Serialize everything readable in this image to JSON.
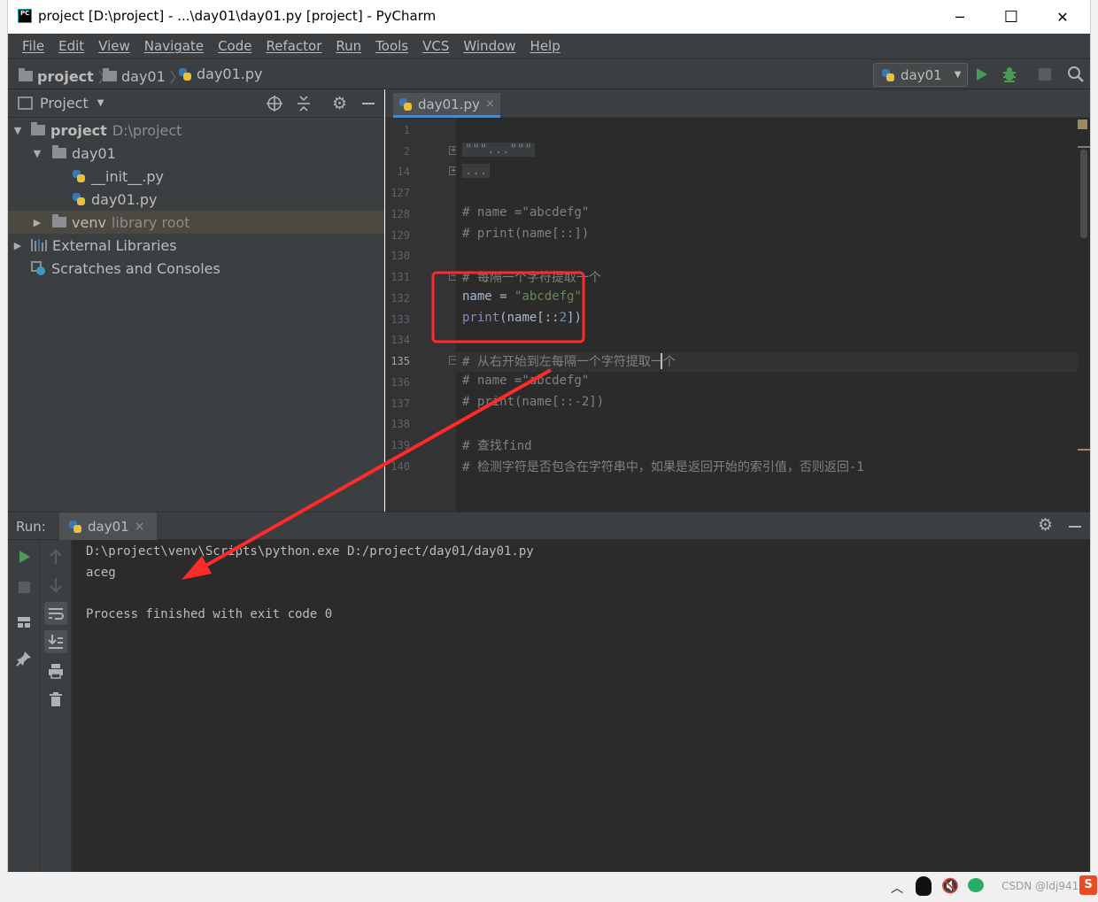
{
  "window": {
    "title": "project [D:\\project] - ...\\day01\\day01.py [project] - PyCharm",
    "logo": "PC",
    "minimize_glyph": "─",
    "maximize_glyph": "☐",
    "close_glyph": "✕"
  },
  "menu": [
    "File",
    "Edit",
    "View",
    "Navigate",
    "Code",
    "Refactor",
    "Run",
    "Tools",
    "VCS",
    "Window",
    "Help"
  ],
  "navbar": {
    "crumbs": [
      "project",
      "day01",
      "day01.py"
    ],
    "separator": "〉",
    "run_config": "day01",
    "icons": [
      "run-icon",
      "debug-icon",
      "stop-icon",
      "search-icon"
    ]
  },
  "project_panel": {
    "title": "Project",
    "tree": [
      {
        "label": "project",
        "extra": "D:\\project",
        "level": 0,
        "toggle": "▼",
        "icon": "folder"
      },
      {
        "label": "day01",
        "extra": "",
        "level": 1,
        "toggle": "▼",
        "icon": "folder"
      },
      {
        "label": "__init__.py",
        "extra": "",
        "level": 2,
        "toggle": "",
        "icon": "python"
      },
      {
        "label": "day01.py",
        "extra": "",
        "level": 2,
        "toggle": "",
        "icon": "python"
      },
      {
        "label": "venv",
        "extra": "library root",
        "level": 1,
        "toggle": "▶",
        "icon": "folder"
      },
      {
        "label": "External Libraries",
        "extra": "",
        "level": 0,
        "toggle": "▶",
        "icon": "libraries"
      },
      {
        "label": "Scratches and Consoles",
        "extra": "",
        "level": 0,
        "toggle": "",
        "icon": "scratches"
      }
    ]
  },
  "editor": {
    "tab": "day01.py",
    "line_numbers": [
      "1",
      "2",
      "14",
      "127",
      "128",
      "129",
      "130",
      "131",
      "132",
      "133",
      "134",
      "135",
      "136",
      "137",
      "138",
      "139",
      "140"
    ],
    "current_line": "135",
    "lines": {
      "l2": "\"\"\"...\"\"\"",
      "l14": "...",
      "l128": "# name =\"abcdefg\"",
      "l129": "# print(name[::])",
      "l131": "# 每隔一个字符提取一个",
      "l132_a": "name = ",
      "l132_b": "\"abcdefg\"",
      "l133_a": "print",
      "l133_b": "(name[::",
      "l133_c": "2",
      "l133_d": "])",
      "l135": "# 从右开始到左每隔一个字符提取一个",
      "l136": "# name =\"abcdefg\"",
      "l137": "# print(name[::-2])",
      "l139": "# 查找find",
      "l140": "# 检测字符是否包含在字符串中，如果是返回开始的索引值，否则返回-1"
    }
  },
  "run_panel": {
    "label": "Run:",
    "tab": "day01",
    "close_glyph": "×",
    "console": [
      "D:\\project\\venv\\Scripts\\python.exe D:/project/day01/day01.py",
      "aceg",
      "",
      "Process finished with exit code 0"
    ]
  },
  "taskbar": {
    "watermark": "CSDN @ldj9411"
  },
  "colors": {
    "annotation": "#ff2a2a",
    "darcula_bg": "#2b2b2b",
    "panel_bg": "#3c3f41"
  }
}
